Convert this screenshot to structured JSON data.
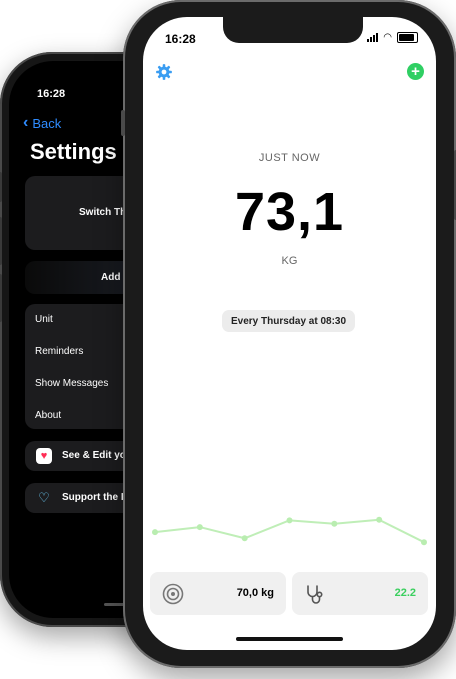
{
  "back_phone": {
    "status_time": "16:28",
    "nav": {
      "back_label": "Back"
    },
    "title": "Settings",
    "switch_card_label": "Switch Th",
    "add_card_label": "Add S",
    "list_items": [
      "Unit",
      "Reminders",
      "Show Messages",
      "About"
    ],
    "health_row_label": "See & Edit yo",
    "support_row_label": "Support the I"
  },
  "front_phone": {
    "status_time": "16:28",
    "toolbar": {
      "settings_icon": "gear-icon",
      "add_icon": "plus-circle-icon",
      "accent": "#2fcf63"
    },
    "last_entry_label": "JUST NOW",
    "weight_value": "73,1",
    "weight_unit": "KG",
    "reminder_chip": "Every Thursday at 08:30",
    "trend_values": [
      48,
      57,
      37,
      69,
      63,
      70,
      30
    ],
    "trend_color": "#bfeeb7",
    "stats": {
      "target": {
        "icon": "target-icon",
        "value": "70,0 kg"
      },
      "bmi": {
        "icon": "stethoscope-icon",
        "value": "22.2",
        "color": "#3acf5e"
      }
    }
  }
}
